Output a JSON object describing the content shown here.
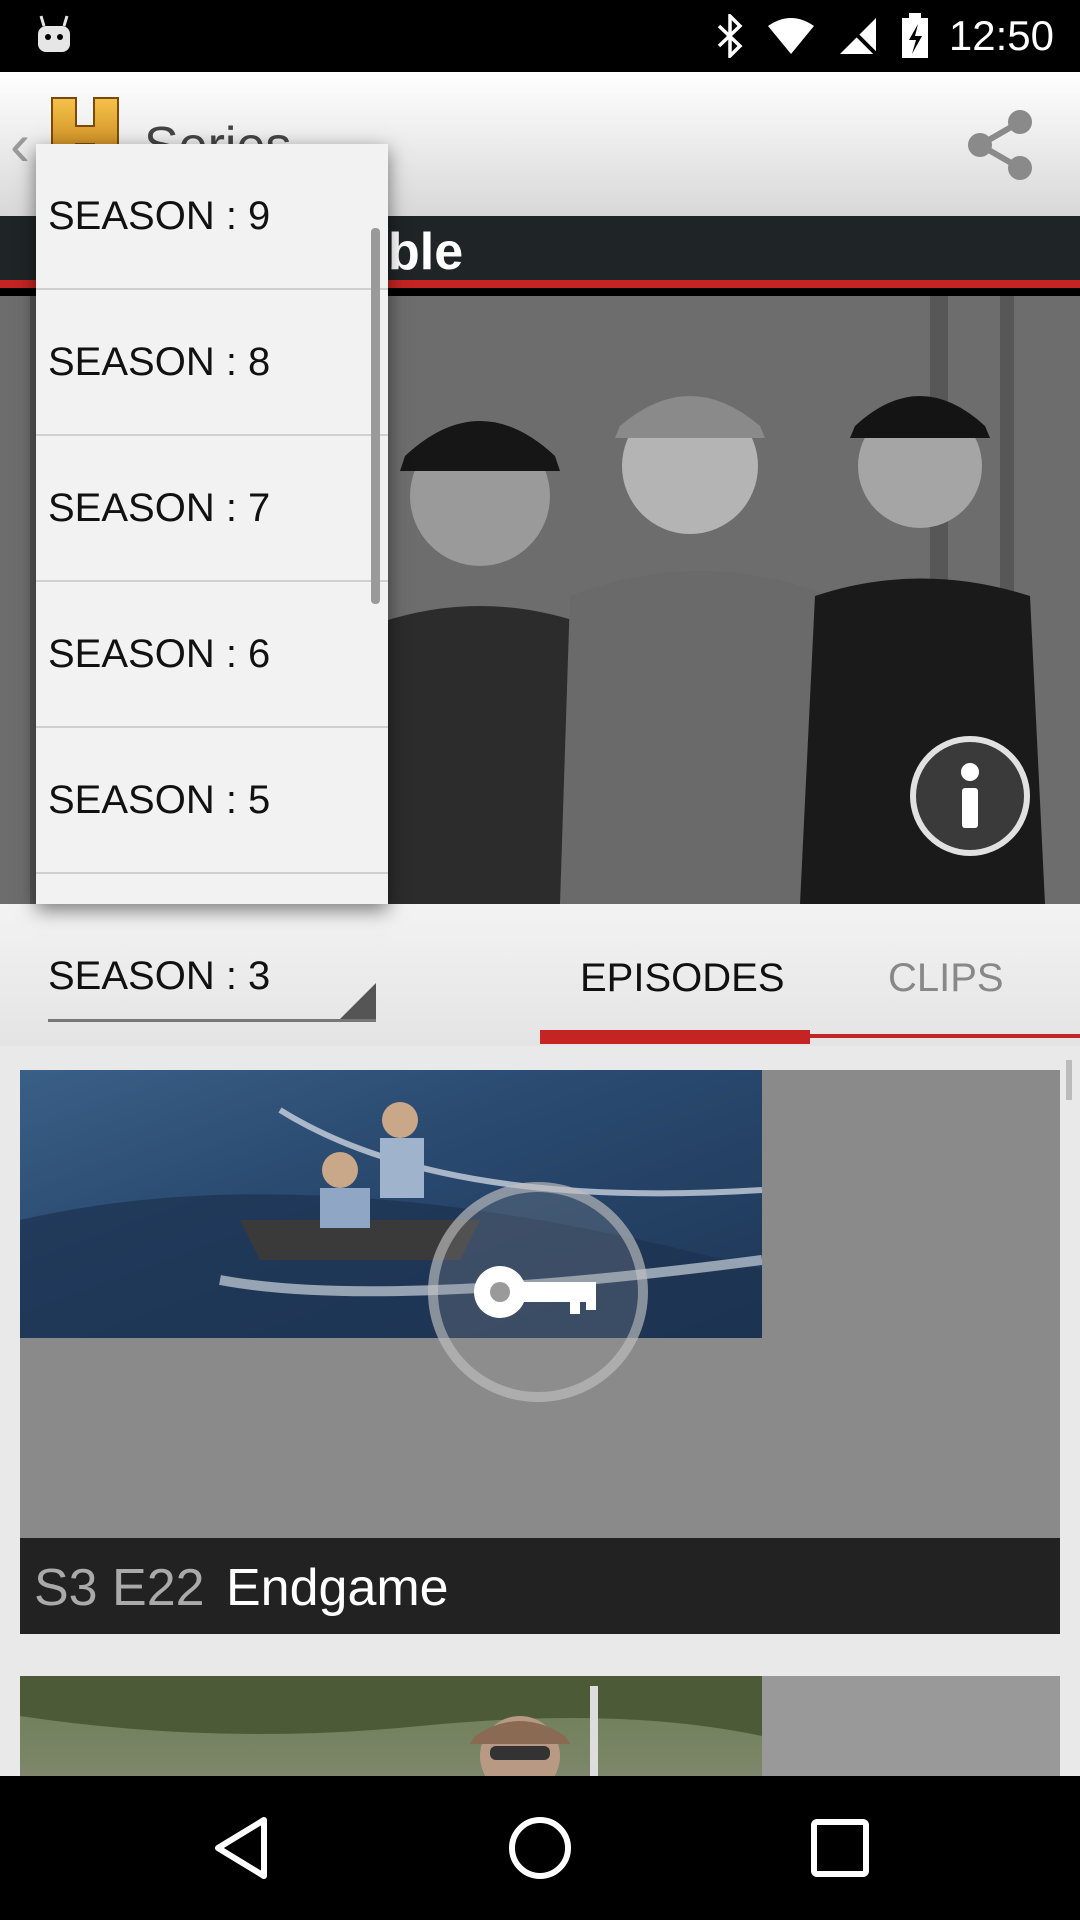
{
  "status_bar": {
    "time": "12:50",
    "icons": [
      "android-debug-icon",
      "bluetooth-icon",
      "wifi-icon",
      "no-sim-icon",
      "battery-charging-icon"
    ]
  },
  "action_bar": {
    "title": "Series",
    "back_glyph": "‹",
    "logo_letter": "H"
  },
  "show": {
    "title": "ble"
  },
  "season_dropdown": {
    "items": [
      "SEASON : 9",
      "SEASON : 8",
      "SEASON : 7",
      "SEASON : 6",
      "SEASON : 5"
    ]
  },
  "season_select": {
    "selected": "SEASON : 3"
  },
  "tabs": {
    "episodes": "EPISODES",
    "clips": "CLIPS"
  },
  "episodes": [
    {
      "code": "S3 E22",
      "title": "Endgame",
      "locked": true
    }
  ],
  "colors": {
    "accent": "#c42424",
    "title_bar": "#1f2426",
    "caption_bg": "#222222"
  }
}
